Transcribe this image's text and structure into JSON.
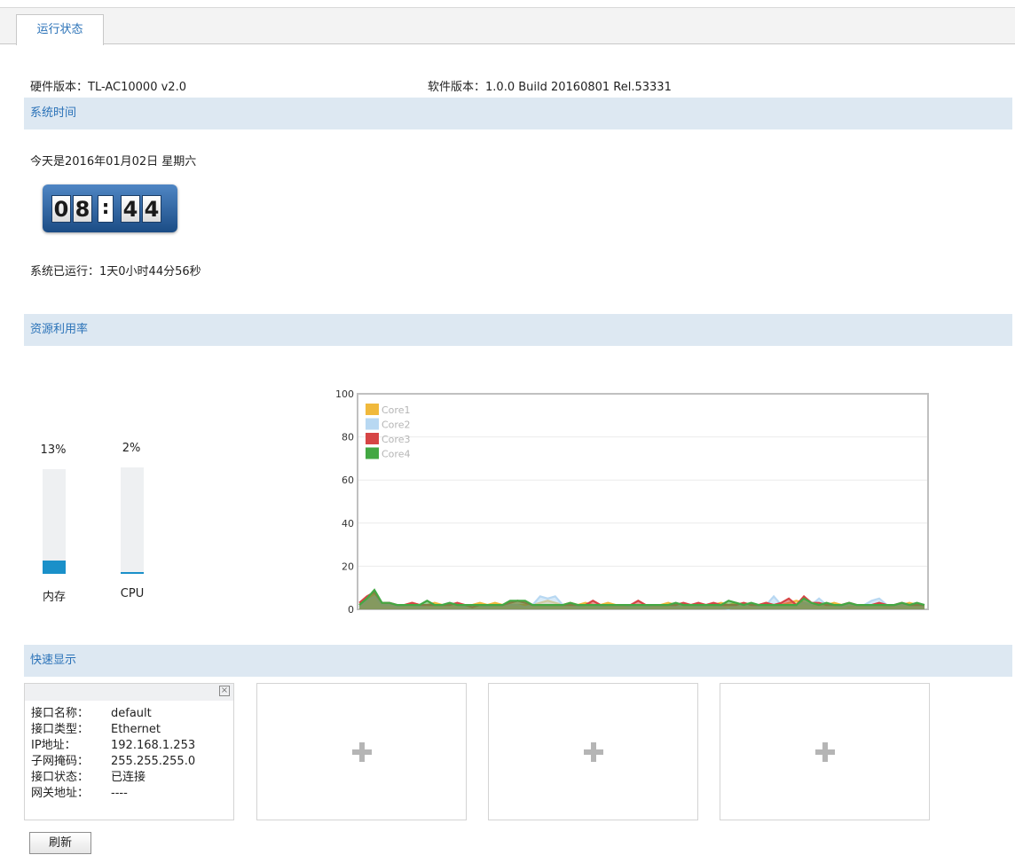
{
  "tabs": [
    {
      "label": "运行状态"
    }
  ],
  "versions": {
    "hardware_label": "硬件版本：",
    "hardware_value": "TL-AC10000 v2.0",
    "software_label": "软件版本：",
    "software_value": "1.0.0 Build 20160801 Rel.53331"
  },
  "system_time": {
    "section_title": "系统时间",
    "date_text": "今天是2016年01月02日 星期六",
    "clock_digits": [
      "0",
      "8",
      ":",
      "4",
      "4"
    ],
    "uptime_text": "系统已运行：1天0小时44分56秒"
  },
  "resources": {
    "section_title": "资源利用率",
    "memory": {
      "label": "内存",
      "percent_text": "13%",
      "percent": 13
    },
    "cpu": {
      "label": "CPU",
      "percent_text": "2%",
      "percent": 2
    }
  },
  "chart_data": {
    "type": "area",
    "title": "",
    "xlabel": "",
    "ylabel": "",
    "ylim": [
      0,
      100
    ],
    "yticks": [
      0,
      20,
      40,
      60,
      80,
      100
    ],
    "grid": true,
    "legend_position": "top-left",
    "series": [
      {
        "name": "Core1",
        "color": "#f0b93c",
        "values": [
          2,
          5,
          7,
          3,
          2,
          2,
          2,
          3,
          2,
          2,
          3,
          2,
          2,
          2,
          2,
          2,
          3,
          2,
          3,
          2,
          2,
          2,
          2,
          2,
          3,
          4,
          3,
          2,
          3,
          2,
          3,
          2,
          2,
          3,
          2,
          2,
          2,
          2,
          2,
          2,
          2,
          3,
          2,
          2,
          2,
          2,
          2,
          2,
          3,
          2,
          3,
          2,
          2,
          2,
          3,
          2,
          2,
          3,
          4,
          3,
          2,
          2,
          2,
          3,
          2,
          1,
          2,
          2,
          2,
          2,
          1,
          2,
          2,
          3,
          2,
          2
        ]
      },
      {
        "name": "Core2",
        "color": "#b8d8f2",
        "values": [
          1,
          4,
          6,
          2,
          2,
          1,
          2,
          2,
          1,
          2,
          2,
          2,
          3,
          2,
          1,
          2,
          2,
          1,
          2,
          2,
          2,
          2,
          1,
          2,
          6,
          5,
          6,
          2,
          2,
          1,
          2,
          2,
          1,
          2,
          2,
          2,
          1,
          2,
          1,
          2,
          2,
          2,
          1,
          2,
          2,
          1,
          2,
          2,
          1,
          0,
          2,
          2,
          2,
          1,
          2,
          6,
          2,
          2,
          2,
          3,
          2,
          5,
          2,
          2,
          1,
          2,
          2,
          2,
          4,
          5,
          2,
          2,
          2,
          2,
          2,
          2
        ]
      },
      {
        "name": "Core3",
        "color": "#d64545",
        "values": [
          3,
          6,
          8,
          3,
          3,
          2,
          2,
          3,
          2,
          2,
          2,
          2,
          2,
          3,
          2,
          1,
          2,
          2,
          2,
          2,
          3,
          4,
          3,
          2,
          2,
          2,
          2,
          2,
          2,
          2,
          2,
          4,
          2,
          2,
          2,
          2,
          2,
          4,
          2,
          2,
          2,
          2,
          2,
          3,
          2,
          3,
          2,
          3,
          2,
          2,
          2,
          3,
          2,
          2,
          3,
          2,
          3,
          5,
          2,
          6,
          3,
          3,
          2,
          2,
          2,
          3,
          2,
          2,
          2,
          3,
          2,
          2,
          3,
          2,
          2,
          2
        ]
      },
      {
        "name": "Core4",
        "color": "#43a843",
        "values": [
          2,
          5,
          9,
          3,
          3,
          2,
          2,
          2,
          2,
          4,
          2,
          2,
          3,
          2,
          2,
          2,
          2,
          2,
          2,
          2,
          4,
          4,
          4,
          2,
          2,
          2,
          2,
          2,
          3,
          2,
          2,
          2,
          2,
          2,
          2,
          2,
          2,
          2,
          2,
          2,
          2,
          2,
          3,
          2,
          2,
          2,
          2,
          2,
          2,
          4,
          3,
          2,
          3,
          2,
          2,
          2,
          2,
          2,
          2,
          5,
          3,
          2,
          3,
          2,
          2,
          3,
          2,
          2,
          2,
          2,
          2,
          2,
          3,
          2,
          3,
          2
        ]
      }
    ]
  },
  "quick_display": {
    "section_title": "快速显示",
    "interface_card": {
      "rows": [
        {
          "label": "接口名称：",
          "value": "default"
        },
        {
          "label": "接口类型：",
          "value": "Ethernet"
        },
        {
          "label": "IP地址：",
          "value": "192.168.1.253"
        },
        {
          "label": "子网掩码：",
          "value": "255.255.255.0"
        },
        {
          "label": "接口状态：",
          "value": "已连接"
        },
        {
          "label": "网关地址：",
          "value": "----"
        }
      ]
    }
  },
  "buttons": {
    "refresh": "刷新"
  }
}
